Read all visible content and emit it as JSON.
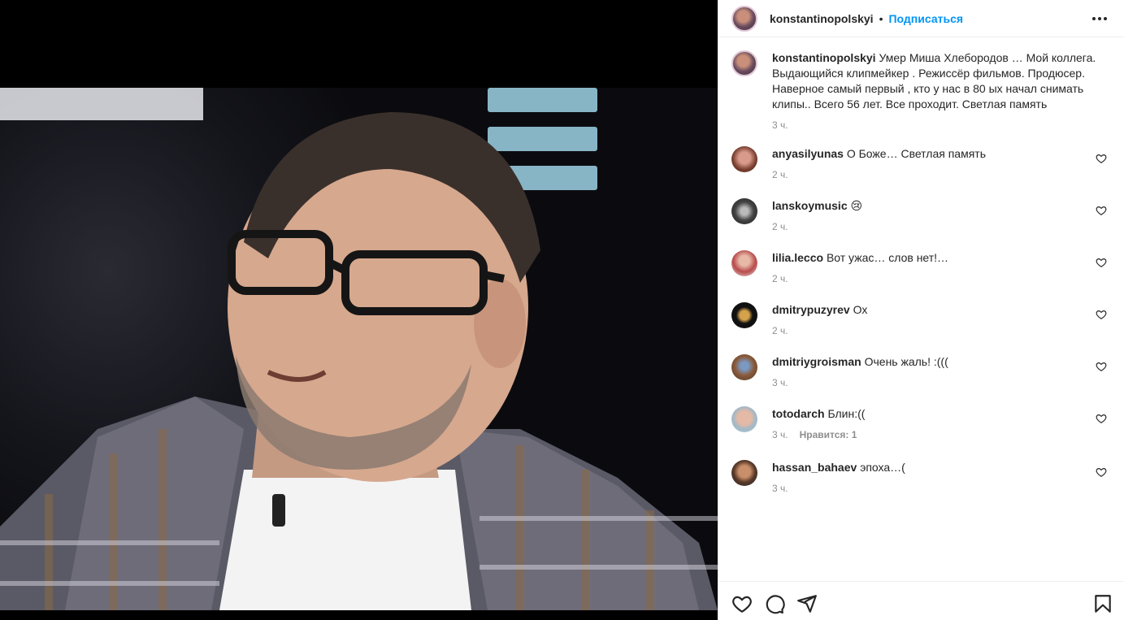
{
  "post": {
    "username": "konstantinopolskyi",
    "separator": "•",
    "follow_label": "Подписаться"
  },
  "caption": {
    "username": "konstantinopolskyi",
    "text": "Умер Миша Хлебородов … Мой коллега. Выдающийся клипмейкер . Режиссёр фильмов. Продюсер. Наверное самый первый , кто у нас в 80 ых начал снимать клипы.. Всего 56 лет. Все проходит. Светлая память",
    "time": "3 ч."
  },
  "comments": [
    {
      "username": "anyasilyunas",
      "text": "О Боже… Светлая память",
      "time": "2 ч.",
      "likes": ""
    },
    {
      "username": "lanskoymusic",
      "text": "😢",
      "time": "2 ч.",
      "likes": ""
    },
    {
      "username": "lilia.lecco",
      "text": "Вот ужас… слов нет!…",
      "time": "2 ч.",
      "likes": ""
    },
    {
      "username": "dmitrypuzyrev",
      "text": "Ох",
      "time": "2 ч.",
      "likes": ""
    },
    {
      "username": "dmitriygroisman",
      "text": "Очень жаль! :(((",
      "time": "3 ч.",
      "likes": ""
    },
    {
      "username": "totodarch",
      "text": "Блин:((",
      "time": "3 ч.",
      "likes": "Нравится: 1"
    },
    {
      "username": "hassan_bahaev",
      "text": "эпоха…(",
      "time": "3 ч.",
      "likes": ""
    }
  ],
  "icons": {
    "like": "heart-icon",
    "comment": "comment-icon",
    "share": "send-icon",
    "save": "bookmark-icon",
    "more": "more-icon"
  },
  "colors": {
    "follow": "#0095f6",
    "text": "#262626",
    "secondary": "#8e8e8e"
  }
}
